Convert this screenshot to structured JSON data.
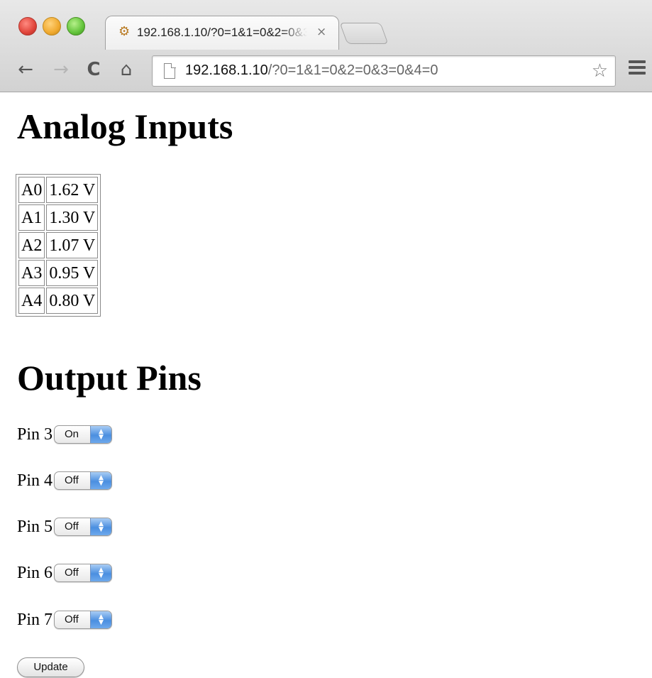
{
  "browser": {
    "tab": {
      "title": "192.168.1.10/?0=1&1=0&2=0&3=0&4=0",
      "close_glyph": "×",
      "favicon": "puzzle-icon"
    },
    "nav": {
      "back_icon": "←",
      "forward_icon": "→",
      "reload_icon": "C",
      "home_icon": "⌂"
    },
    "address": {
      "host": "192.168.1.10",
      "path": "/?0=1&1=0&2=0&3=0&4=0"
    },
    "star_icon": "☆"
  },
  "page": {
    "analog_heading": "Analog Inputs",
    "readings": [
      {
        "channel": "A0",
        "value": "1.62 V"
      },
      {
        "channel": "A1",
        "value": "1.30 V"
      },
      {
        "channel": "A2",
        "value": "1.07 V"
      },
      {
        "channel": "A3",
        "value": "0.95 V"
      },
      {
        "channel": "A4",
        "value": "0.80 V"
      }
    ],
    "output_heading": "Output Pins",
    "pins": [
      {
        "label": "Pin 3",
        "state": "On"
      },
      {
        "label": "Pin 4",
        "state": "Off"
      },
      {
        "label": "Pin 5",
        "state": "Off"
      },
      {
        "label": "Pin 6",
        "state": "Off"
      },
      {
        "label": "Pin 7",
        "state": "Off"
      }
    ],
    "update_label": "Update"
  }
}
